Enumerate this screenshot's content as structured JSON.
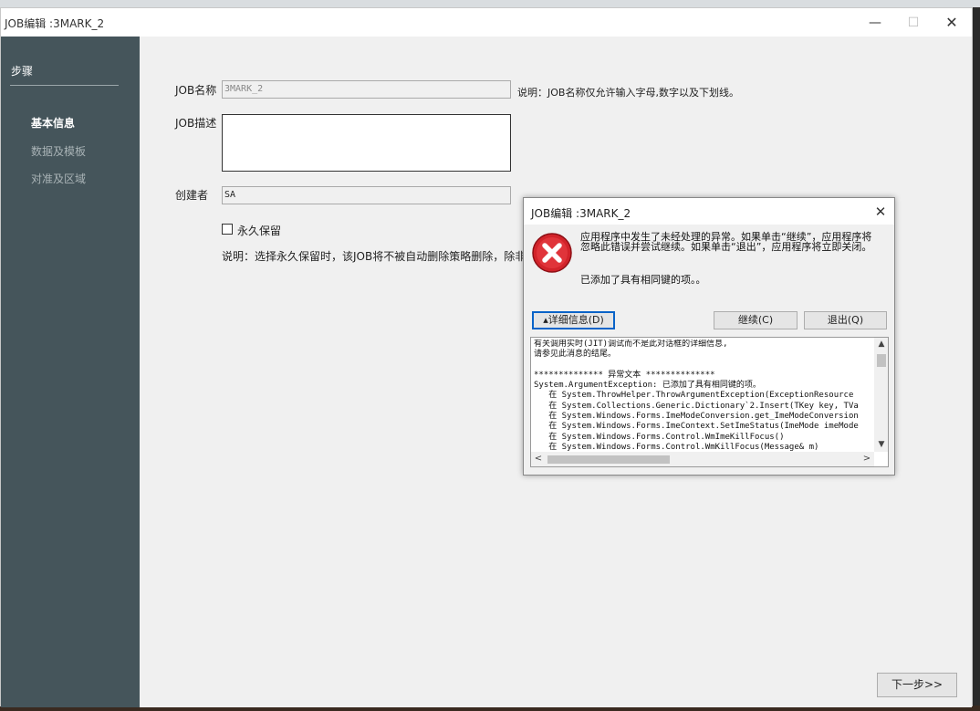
{
  "window": {
    "title": "JOB编辑 :3MARK_2",
    "min_glyph": "—",
    "max_glyph": "☐",
    "close_glyph": "✕"
  },
  "sidebar": {
    "title": "步骤",
    "steps": [
      {
        "label": "基本信息",
        "active": true
      },
      {
        "label": "数据及模板",
        "active": false
      },
      {
        "label": "对准及区域",
        "active": false
      }
    ]
  },
  "form": {
    "job_name_label": "JOB名称",
    "job_name_value": "3MARK_2",
    "job_name_hint": "说明：JOB名称仅允许输入字母,数字以及下划线。",
    "job_desc_label": "JOB描述",
    "job_desc_value": "",
    "creator_label": "创建者",
    "creator_value": "SA",
    "permanent_label": "永久保留",
    "permanent_checked": false,
    "note": "说明：选择永久保留时，该JOB将不被自动删除策略删除，除非用户"
  },
  "next_button": "下一步>>",
  "dialog": {
    "title": "JOB编辑 :3MARK_2",
    "close_glyph": "✕",
    "icon": "error-icon",
    "message": "应用程序中发生了未经处理的异常。如果单击“继续”，应用程序将忽略此错误并尝试继续。如果单击“退出”，应用程序将立即关闭。",
    "message2": "已添加了具有相同键的项。。",
    "details_button": "▴详细信息(D)",
    "continue_button": "继续(C)",
    "quit_button": "退出(Q)",
    "details_lines": [
      "有关调用实时(JIT)调试而不是此对话框的详细信息,",
      "请参见此消息的结尾。",
      "",
      "************** 异常文本 **************",
      "System.ArgumentException: 已添加了具有相同键的项。",
      "   在 System.ThrowHelper.ThrowArgumentException(ExceptionResource",
      "   在 System.Collections.Generic.Dictionary`2.Insert(TKey key, TVa",
      "   在 System.Windows.Forms.ImeModeConversion.get_ImeModeConversion",
      "   在 System.Windows.Forms.ImeContext.SetImeStatus(ImeMode imeMode",
      "   在 System.Windows.Forms.Control.WmImeKillFocus()",
      "   在 System.Windows.Forms.Control.WmKillFocus(Message& m)"
    ],
    "scroll_up_glyph": "▲",
    "scroll_down_glyph": "▼",
    "scroll_left_glyph": "<",
    "scroll_right_glyph": ">"
  },
  "colors": {
    "sidebar_bg": "#45555b",
    "content_bg": "#f0f0f0",
    "error_red": "#d2232a",
    "focus_blue": "#0a64c8"
  }
}
